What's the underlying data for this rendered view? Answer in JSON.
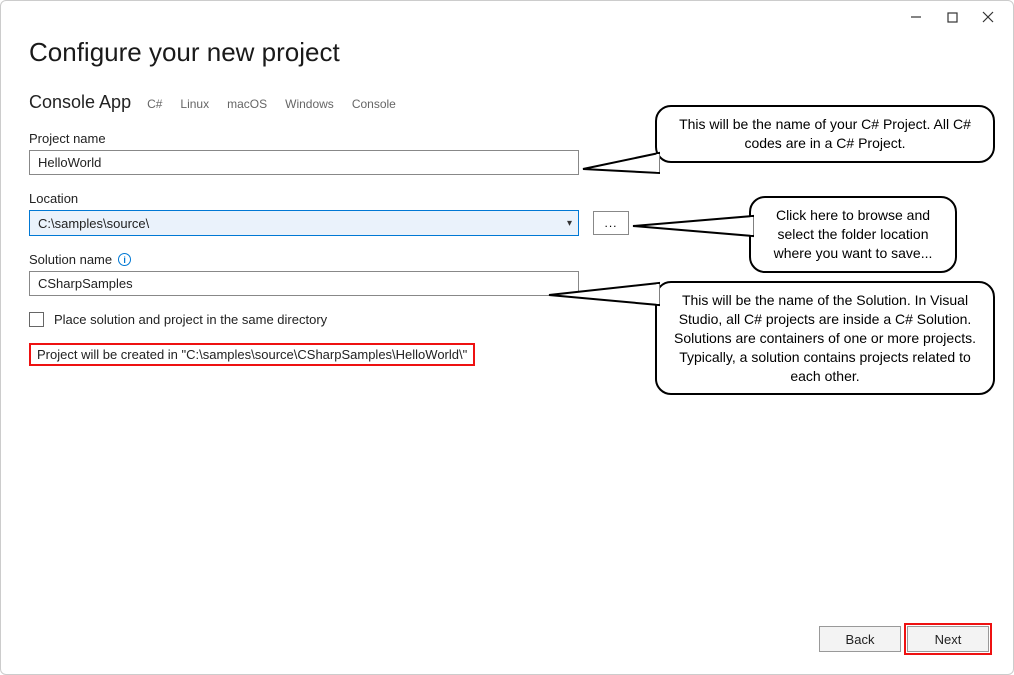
{
  "header": {
    "title": "Configure your new project",
    "app_type": "Console App",
    "tags": [
      "C#",
      "Linux",
      "macOS",
      "Windows",
      "Console"
    ]
  },
  "fields": {
    "project_name": {
      "label": "Project name",
      "value": "HelloWorld"
    },
    "location": {
      "label": "Location",
      "value": "C:\\samples\\source\\"
    },
    "solution_name": {
      "label": "Solution name",
      "value": "CSharpSamples"
    },
    "checkbox_label": "Place solution and project in the same directory",
    "browse_label": "...",
    "path_message": "Project will be created in \"C:\\samples\\source\\CSharpSamples\\HelloWorld\\\""
  },
  "footer": {
    "back": "Back",
    "next": "Next"
  },
  "callouts": {
    "c1": "This will be the name of your C# Project. All C# codes are in a C# Project.",
    "c2": "Click here to browse and select the folder location where you want to save...",
    "c3": "This will be the name of the Solution. In Visual Studio, all C# projects are inside a C# Solution. Solutions are containers of one or more projects. Typically, a solution contains projects related to each other."
  }
}
